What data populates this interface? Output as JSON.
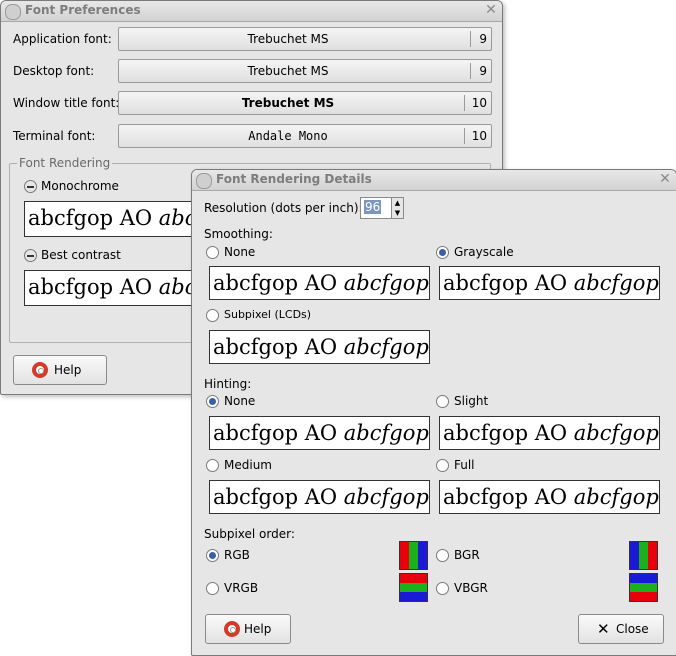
{
  "back_window": {
    "title": "Font Preferences",
    "fonts": [
      {
        "label": "Application font:",
        "name": "Trebuchet MS",
        "size": "9"
      },
      {
        "label": "Desktop font:",
        "name": "Trebuchet MS",
        "size": "9"
      },
      {
        "label": "Window title font:",
        "name": "Trebuchet MS",
        "size": "10"
      },
      {
        "label": "Terminal font:",
        "name": "Andale Mono",
        "size": "10"
      }
    ],
    "rendering": {
      "title": "Font Rendering",
      "monochrome": "Monochrome",
      "best_contrast": "Best contrast",
      "sample_regular": "abcfgop AO ",
      "sample_italic": "abcfgop"
    },
    "help_label": "Help"
  },
  "front_window": {
    "title": "Font Rendering Details",
    "resolution_label": "Resolution (dots per inch):",
    "resolution_value": "96",
    "smoothing": {
      "label": "Smoothing:",
      "options": [
        "None",
        "Grayscale",
        "Subpixel (LCDs)"
      ],
      "selected": "Grayscale"
    },
    "hinting": {
      "label": "Hinting:",
      "options": [
        "None",
        "Slight",
        "Medium",
        "Full"
      ],
      "selected": "None"
    },
    "subpixel_order": {
      "label": "Subpixel order:",
      "options": [
        "RGB",
        "BGR",
        "VRGB",
        "VBGR"
      ],
      "selected": "RGB",
      "colors": {
        "red": "#e8000b",
        "green": "#1cb01c",
        "blue": "#1a1ad6"
      }
    },
    "sample_regular": "abcfgop AO ",
    "sample_italic": "abcfgop",
    "help_label": "Help",
    "close_label": "Close",
    "close_icon": "x-icon"
  }
}
